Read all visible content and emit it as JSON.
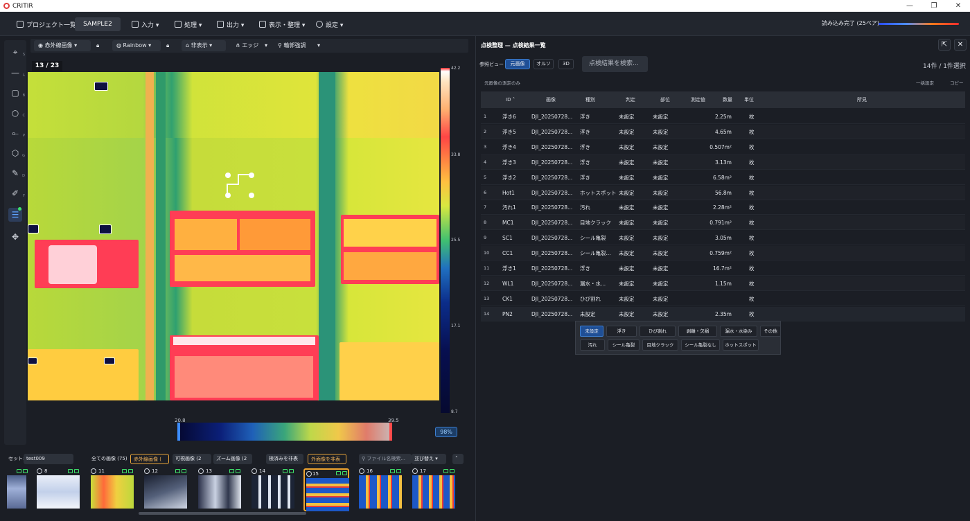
{
  "window": {
    "title": "CRITIR",
    "minimize": "—",
    "maximize": "❐",
    "close": "✕"
  },
  "menu": {
    "projects": "プロジェクト一覧",
    "project_tab": "SAMPLE2",
    "items": [
      "入力 ▾",
      "処理 ▾",
      "出力 ▾",
      "表示・整理 ▾",
      "設定 ▾"
    ],
    "load_status": "読み込み完了 (25ペア)"
  },
  "tools": [
    {
      "icon": "crosshair-icon",
      "glyph": "⌖",
      "key": "S"
    },
    {
      "icon": "line-icon",
      "glyph": "—",
      "key": "L"
    },
    {
      "icon": "rectangle-icon",
      "glyph": "▢",
      "key": "B"
    },
    {
      "icon": "circle-icon",
      "glyph": "○",
      "key": "C"
    },
    {
      "icon": "polyline-icon",
      "glyph": "⟜",
      "key": "P"
    },
    {
      "icon": "polygon-icon",
      "glyph": "⬡",
      "key": "G"
    },
    {
      "icon": "pen-icon",
      "glyph": "✎",
      "key": "D"
    },
    {
      "icon": "edit-icon",
      "glyph": "✐",
      "key": "F"
    },
    {
      "icon": "sliders-icon",
      "glyph": "☰",
      "key": ""
    },
    {
      "icon": "move-icon",
      "glyph": "✥",
      "key": ""
    }
  ],
  "viewer": {
    "mode": "赤外線画像 ▾",
    "palette": "Rainbow ▾",
    "label": "非表示 ▾",
    "edge": "エッジ",
    "edge_dd": "▾",
    "contour": "輪郭強調",
    "contour_dd": "▾",
    "counter": "13 / 23",
    "scale_max": "42.2",
    "scale_2": "33.8",
    "scale_3": "25.5",
    "scale_4": "17.1",
    "scale_min": "8.7",
    "hist_min": "20.8",
    "hist_max": "39.5",
    "zoom": "98%"
  },
  "filmstrip": {
    "set_label": "セット:",
    "set_value": "test009",
    "tabs": [
      "全ての画像 (75)",
      "赤外線画像 (",
      "可視画像 (2",
      "ズーム画像 (2"
    ],
    "done": "検済みを非表",
    "outer": "外面像を非表",
    "search": "ファイル名検索...",
    "sort": "並び替え ▾",
    "thumbs": [
      {
        "num": ""
      },
      {
        "num": "8"
      },
      {
        "num": "11"
      },
      {
        "num": "12"
      },
      {
        "num": "13"
      },
      {
        "num": "14"
      },
      {
        "num": "15"
      },
      {
        "num": "16"
      },
      {
        "num": "17"
      }
    ]
  },
  "panel": {
    "title": "点検整理 — 点検結果一覧",
    "ref_label": "参照ビュー",
    "views": [
      "元画像",
      "オルソ",
      "3D"
    ],
    "search": "点検結果を検索...",
    "count": "14件 / 1件選択",
    "sub_left": "元画像の測定のみ",
    "bulk": "一括設定",
    "copy": "コピー",
    "headers": [
      "ID",
      "画像",
      "種別",
      "判定",
      "部位",
      "測定値",
      "数量",
      "単位",
      "所見"
    ],
    "rows": [
      {
        "n": "1",
        "id": "浮き6",
        "img": "DJI_20250728...",
        "type": "浮き",
        "judge": "未設定",
        "part": "未設定",
        "value": "2.25m",
        "unit": "枚"
      },
      {
        "n": "2",
        "id": "浮き5",
        "img": "DJI_20250728...",
        "type": "浮き",
        "judge": "未設定",
        "part": "未設定",
        "value": "4.65m",
        "unit": "枚"
      },
      {
        "n": "3",
        "id": "浮き4",
        "img": "DJI_20250728...",
        "type": "浮き",
        "judge": "未設定",
        "part": "未設定",
        "value": "0.507m²",
        "unit": "枚"
      },
      {
        "n": "4",
        "id": "浮き3",
        "img": "DJI_20250728...",
        "type": "浮き",
        "judge": "未設定",
        "part": "未設定",
        "value": "3.13m",
        "unit": "枚"
      },
      {
        "n": "5",
        "id": "浮き2",
        "img": "DJI_20250728...",
        "type": "浮き",
        "judge": "未設定",
        "part": "未設定",
        "value": "6.58m²",
        "unit": "枚"
      },
      {
        "n": "6",
        "id": "Hot1",
        "img": "DJI_20250728...",
        "type": "ホットスポット",
        "judge": "未設定",
        "part": "未設定",
        "value": "56.8m",
        "unit": "枚"
      },
      {
        "n": "7",
        "id": "汚れ1",
        "img": "DJI_20250728...",
        "type": "汚れ",
        "judge": "未設定",
        "part": "未設定",
        "value": "2.28m²",
        "unit": "枚"
      },
      {
        "n": "8",
        "id": "MC1",
        "img": "DJI_20250728...",
        "type": "目地クラック",
        "judge": "未設定",
        "part": "未設定",
        "value": "0.791m²",
        "unit": "枚"
      },
      {
        "n": "9",
        "id": "SC1",
        "img": "DJI_20250728...",
        "type": "シール亀裂",
        "judge": "未設定",
        "part": "未設定",
        "value": "3.05m",
        "unit": "枚"
      },
      {
        "n": "10",
        "id": "CC1",
        "img": "DJI_20250728...",
        "type": "シール亀裂...",
        "judge": "未設定",
        "part": "未設定",
        "value": "0.759m²",
        "unit": "枚"
      },
      {
        "n": "11",
        "id": "浮き1",
        "img": "DJI_20250728...",
        "type": "浮き",
        "judge": "未設定",
        "part": "未設定",
        "value": "16.7m²",
        "unit": "枚"
      },
      {
        "n": "12",
        "id": "WL1",
        "img": "DJI_20250728...",
        "type": "漏水・水...",
        "judge": "未設定",
        "part": "未設定",
        "value": "1.15m",
        "unit": "枚"
      },
      {
        "n": "13",
        "id": "CK1",
        "img": "DJI_20250728...",
        "type": "ひび割れ",
        "judge": "未設定",
        "part": "未設定",
        "value": "",
        "unit": "枚"
      },
      {
        "n": "14",
        "id": "PN2",
        "img": "DJI_20250728...",
        "type": "未設定",
        "judge": "未設定",
        "part": "未設定",
        "value": "2.35m",
        "unit": "枚"
      }
    ],
    "type_options_row1": [
      "未設定",
      "浮き",
      "ひび割れ",
      "剥離・欠損",
      "漏水・水染み",
      "その他"
    ],
    "type_options_row2": [
      "汚れ",
      "シール亀裂",
      "目地クラック",
      "シール亀裂なし",
      "ホットスポット"
    ]
  }
}
